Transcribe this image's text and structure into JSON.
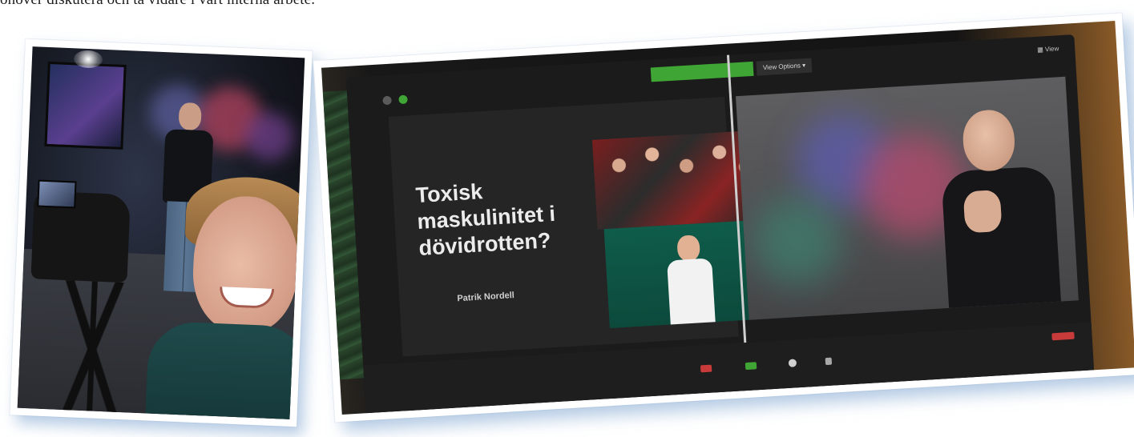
{
  "intro": {
    "text": "önover diskutera och ta vidare i vårt interna arbete."
  },
  "photo_right": {
    "zoom": {
      "view_options_label": "View Options ▾",
      "view_label": "▦ View"
    },
    "slide": {
      "title_line_1": "Toxisk",
      "title_line_2": "maskulinitet i",
      "title_line_3": "dövidrotten?",
      "author": "Patrik Nordell"
    }
  },
  "colors": {
    "zoom_green": "#3fa535",
    "photo_shadow": "#78a0cd"
  }
}
